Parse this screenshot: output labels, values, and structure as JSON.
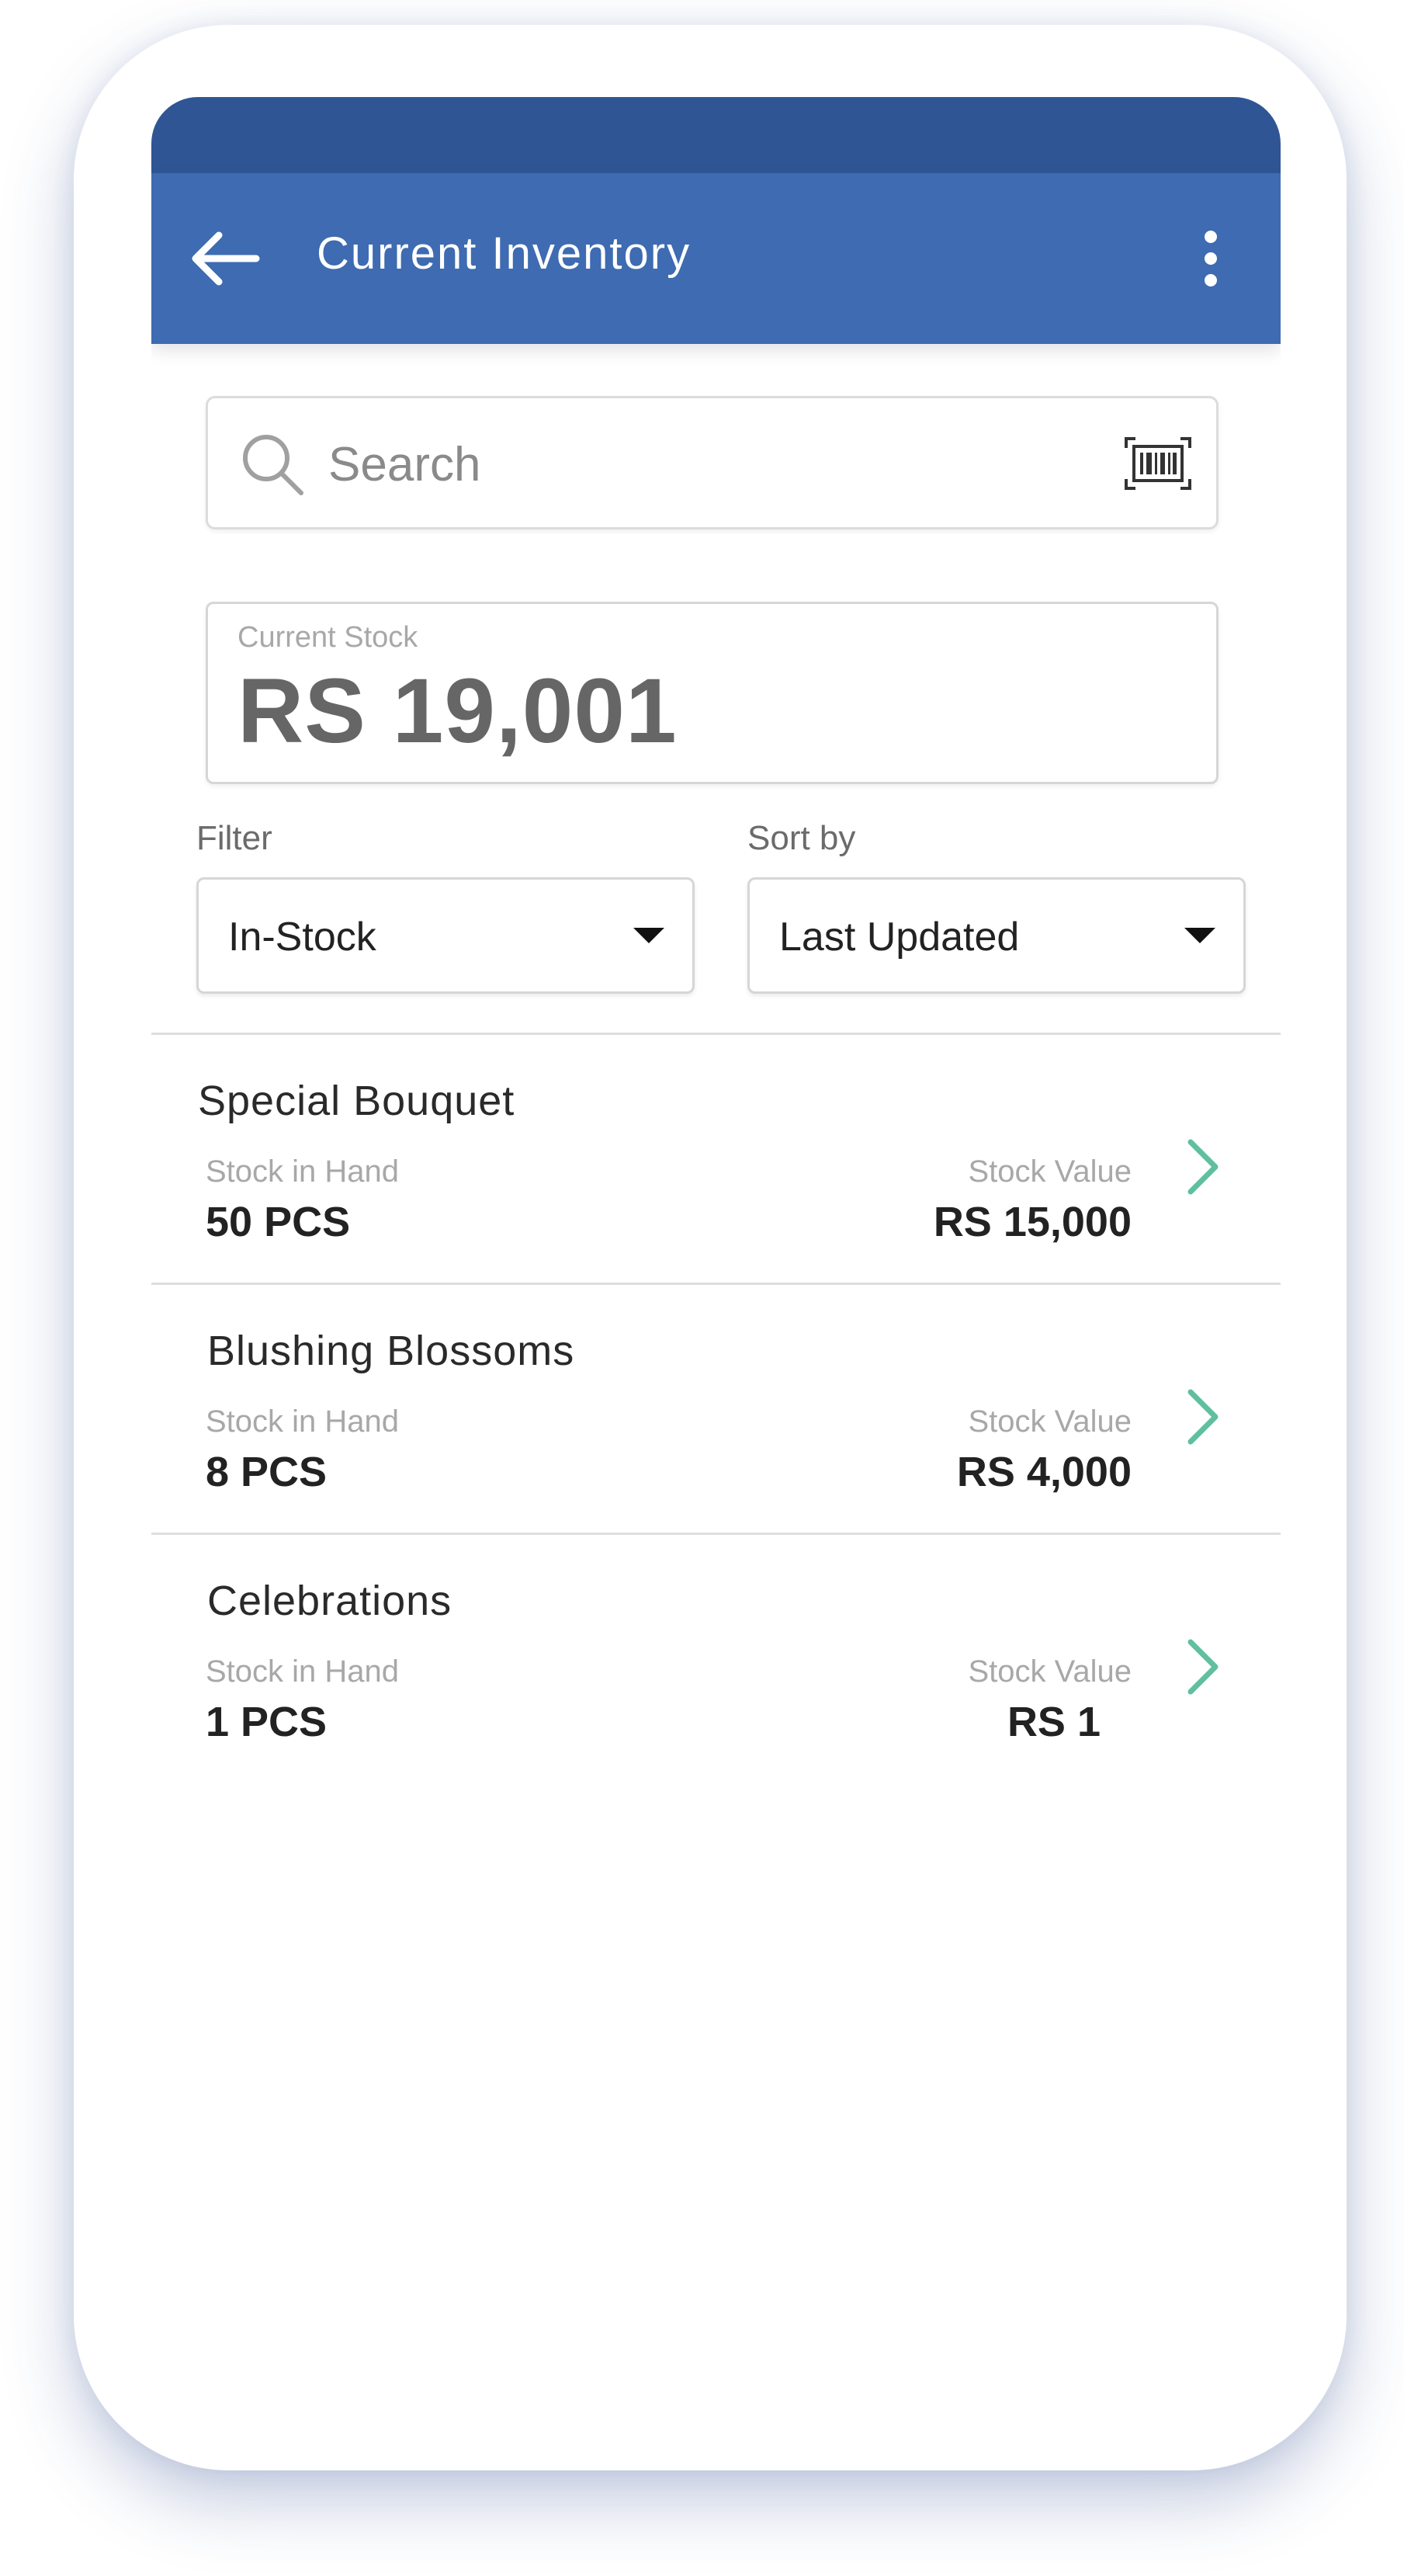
{
  "app_bar": {
    "title": "Current Inventory",
    "back_icon": "back-arrow-icon",
    "menu_icon": "more-vertical-icon"
  },
  "search": {
    "placeholder": "Search",
    "value": "",
    "search_icon": "search-icon",
    "scan_icon": "barcode-scanner-icon"
  },
  "current_stock": {
    "label": "Current Stock",
    "value": "RS 19,001"
  },
  "filter": {
    "label": "Filter",
    "selected": "In-Stock"
  },
  "sort": {
    "label": "Sort by",
    "selected": "Last Updated"
  },
  "items": [
    {
      "name": "Special Bouquet",
      "stock_in_hand_label": "Stock in Hand",
      "stock_in_hand": "50 PCS",
      "stock_value_label": "Stock Value",
      "stock_value": "RS 15,000"
    },
    {
      "name": "Blushing Blossoms",
      "stock_in_hand_label": "Stock in Hand",
      "stock_in_hand": "8 PCS",
      "stock_value_label": "Stock Value",
      "stock_value": "RS 4,000"
    },
    {
      "name": "Celebrations",
      "stock_in_hand_label": "Stock in Hand",
      "stock_in_hand": "1 PCS",
      "stock_value_label": "Stock Value",
      "stock_value": "RS 1"
    }
  ],
  "colors": {
    "status_bar": "#2f5594",
    "app_bar": "#3e6bb1",
    "chevron": "#5fbf9f"
  }
}
